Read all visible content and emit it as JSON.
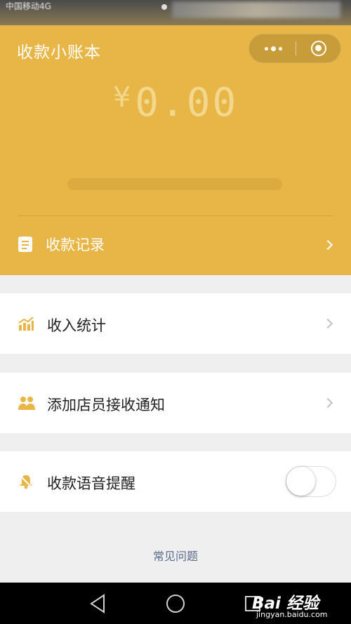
{
  "status_bar": {
    "carrier": "中国移动4G"
  },
  "header": {
    "title": "收款小账本",
    "currency_symbol": "¥",
    "amount": "0.00",
    "record_label": "收款记录"
  },
  "menu": {
    "income_stats": "收入统计",
    "add_staff": "添加店员接收通知",
    "voice_reminder": "收款语音提醒",
    "voice_reminder_on": false
  },
  "faq_link": "常见问题",
  "watermark": {
    "brand": "Bai 经验",
    "site": "jingyan.baidu.com"
  },
  "colors": {
    "accent": "#e8b646",
    "link": "#5b6b8b",
    "background": "#efefef"
  },
  "icons": [
    "more-icon",
    "target-icon",
    "document-icon",
    "chart-icon",
    "people-icon",
    "bell-icon",
    "chevron-right-icon",
    "back-icon",
    "home-icon",
    "recents-icon"
  ]
}
